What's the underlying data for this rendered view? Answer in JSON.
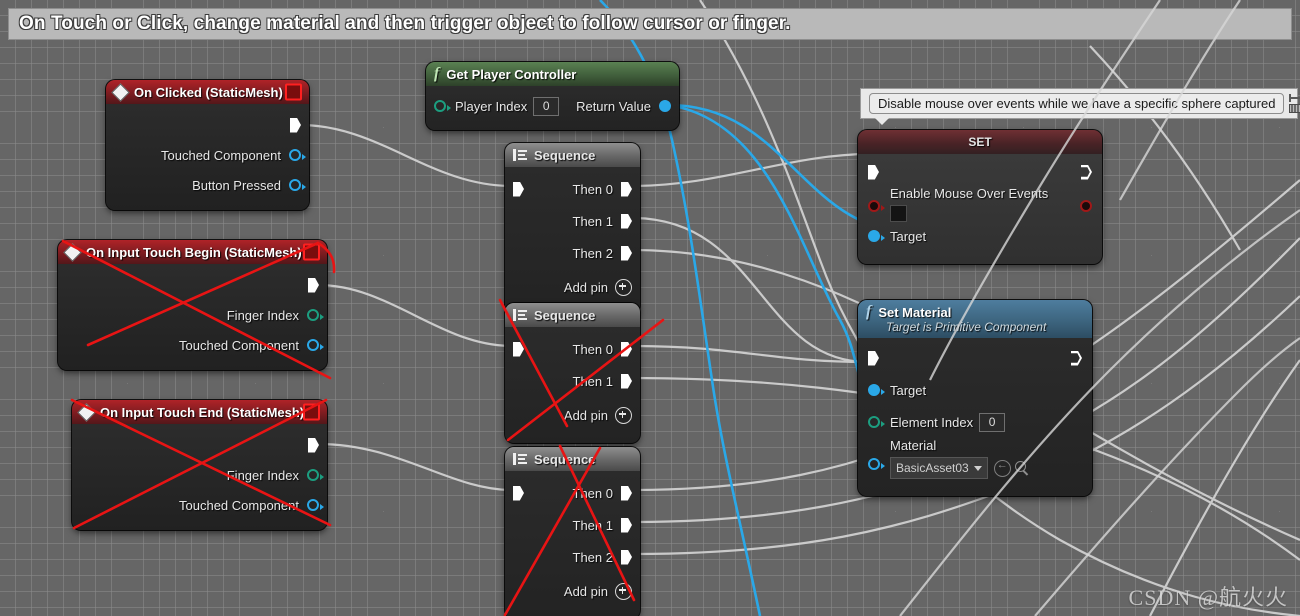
{
  "graph": {
    "title": "On Touch or Click, change material and then trigger object to follow cursor or finger.",
    "watermark": "CSDN @航火火",
    "accent_red": "#b02328",
    "accent_green": "#5a8152",
    "accent_blue": "#4e7d9e",
    "wire_exec_color": "#d8d8d8",
    "wire_object_color": "#2aa8e8",
    "strike_color": "#e81414"
  },
  "comment_bubble": {
    "text": "Disable mouse over events while we have a specific sphere captured",
    "icon_pin": "pin-icon",
    "icon_grid": "grid-icon"
  },
  "nodes": {
    "on_clicked": {
      "title": "On Clicked (StaticMesh)",
      "icon": "event-diamond-icon",
      "delegate_icon": "red-square-icon",
      "exec_out": "exec-out",
      "pins": [
        {
          "label": "Touched Component",
          "type": "object"
        },
        {
          "label": "Button Pressed",
          "type": "object"
        }
      ]
    },
    "on_touch_begin": {
      "title": "On Input Touch Begin (StaticMesh)",
      "icon": "event-diamond-icon",
      "delegate_icon": "red-square-icon",
      "pins": [
        {
          "label": "Finger Index",
          "type": "int"
        },
        {
          "label": "Touched Component",
          "type": "object"
        }
      ]
    },
    "on_touch_end": {
      "title": "On Input Touch End (StaticMesh)",
      "icon": "event-diamond-icon",
      "delegate_icon": "red-square-icon",
      "pins": [
        {
          "label": "Finger Index",
          "type": "int"
        },
        {
          "label": "Touched Component",
          "type": "object"
        }
      ]
    },
    "get_player_controller": {
      "title": "Get Player Controller",
      "icon": "function-f-icon",
      "input": {
        "label": "Player Index",
        "type": "int",
        "value": "0"
      },
      "output": {
        "label": "Return Value",
        "type": "object"
      }
    },
    "sequence_1": {
      "title": "Sequence",
      "icon": "sequence-icon",
      "outputs": [
        "Then 0",
        "Then 1",
        "Then 2"
      ],
      "add_pin": "Add pin"
    },
    "sequence_2": {
      "title": "Sequence",
      "icon": "sequence-icon",
      "outputs": [
        "Then 0",
        "Then 1"
      ],
      "add_pin": "Add pin"
    },
    "sequence_3": {
      "title": "Sequence",
      "icon": "sequence-icon",
      "outputs": [
        "Then 0",
        "Then 1",
        "Then 2"
      ],
      "add_pin": "Add pin"
    },
    "set_node": {
      "title": "SET",
      "property": {
        "label": "Enable Mouse Over Events",
        "type": "bool",
        "checked": false
      },
      "target": {
        "label": "Target",
        "type": "object"
      }
    },
    "set_material": {
      "title": "Set Material",
      "subtitle": "Target is Primitive Component",
      "icon": "function-f-icon",
      "target": {
        "label": "Target",
        "type": "object"
      },
      "element_index": {
        "label": "Element Index",
        "type": "int",
        "value": "0"
      },
      "material": {
        "label": "Material",
        "value": "BasicAsset03",
        "browse_icon": "browse-back-icon",
        "find_icon": "magnifier-icon"
      }
    }
  }
}
